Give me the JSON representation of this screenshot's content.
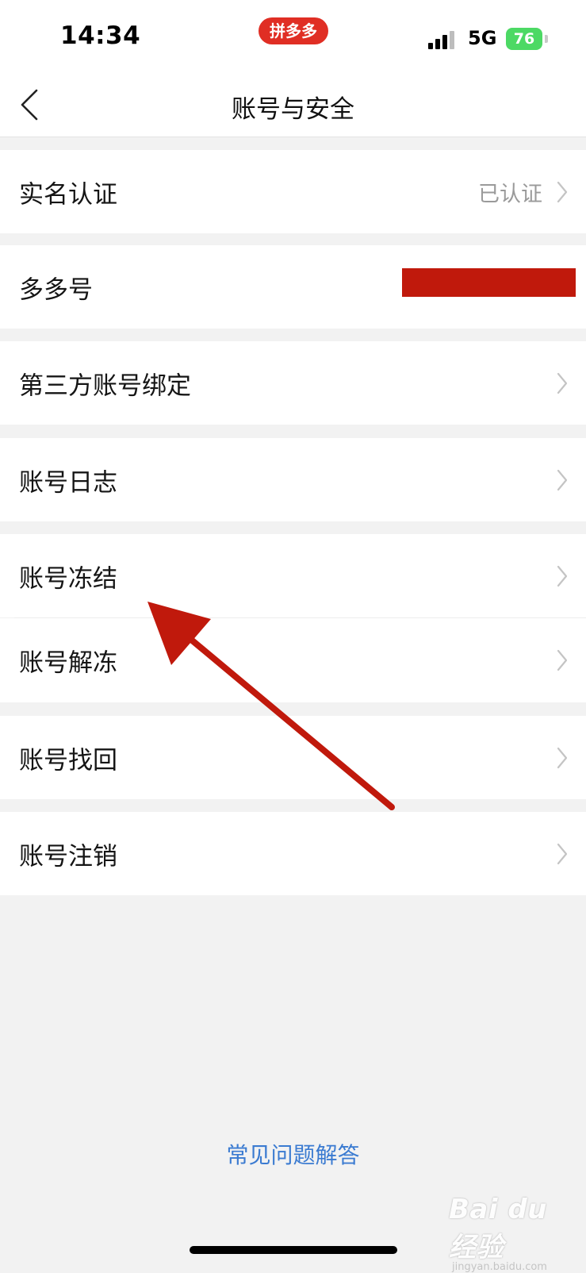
{
  "status_bar": {
    "time": "14:34",
    "app_badge": "拼多多",
    "network": "5G",
    "battery": "76"
  },
  "nav": {
    "title": "账号与安全"
  },
  "rows": [
    {
      "label": "实名认证",
      "value": "已认证",
      "chevron": true
    },
    {
      "label": "多多号",
      "value_redacted": true,
      "chevron": false
    },
    {
      "label": "第三方账号绑定",
      "chevron": true
    },
    {
      "label": "账号日志",
      "chevron": true
    },
    {
      "label": "账号冻结",
      "chevron": true
    },
    {
      "label": "账号解冻",
      "chevron": true
    },
    {
      "label": "账号找回",
      "chevron": true
    },
    {
      "label": "账号注销",
      "chevron": true
    }
  ],
  "faq_link": "常见问题解答",
  "watermark": {
    "main": "Bai du 经验",
    "sub": "jingyan.baidu.com"
  },
  "colors": {
    "accent_link": "#3b7bd1",
    "annotation_arrow": "#c0190c",
    "app_badge": "#e02e24",
    "battery": "#4cd964"
  },
  "annotation": {
    "type": "arrow",
    "points_to": "账号冻结"
  }
}
